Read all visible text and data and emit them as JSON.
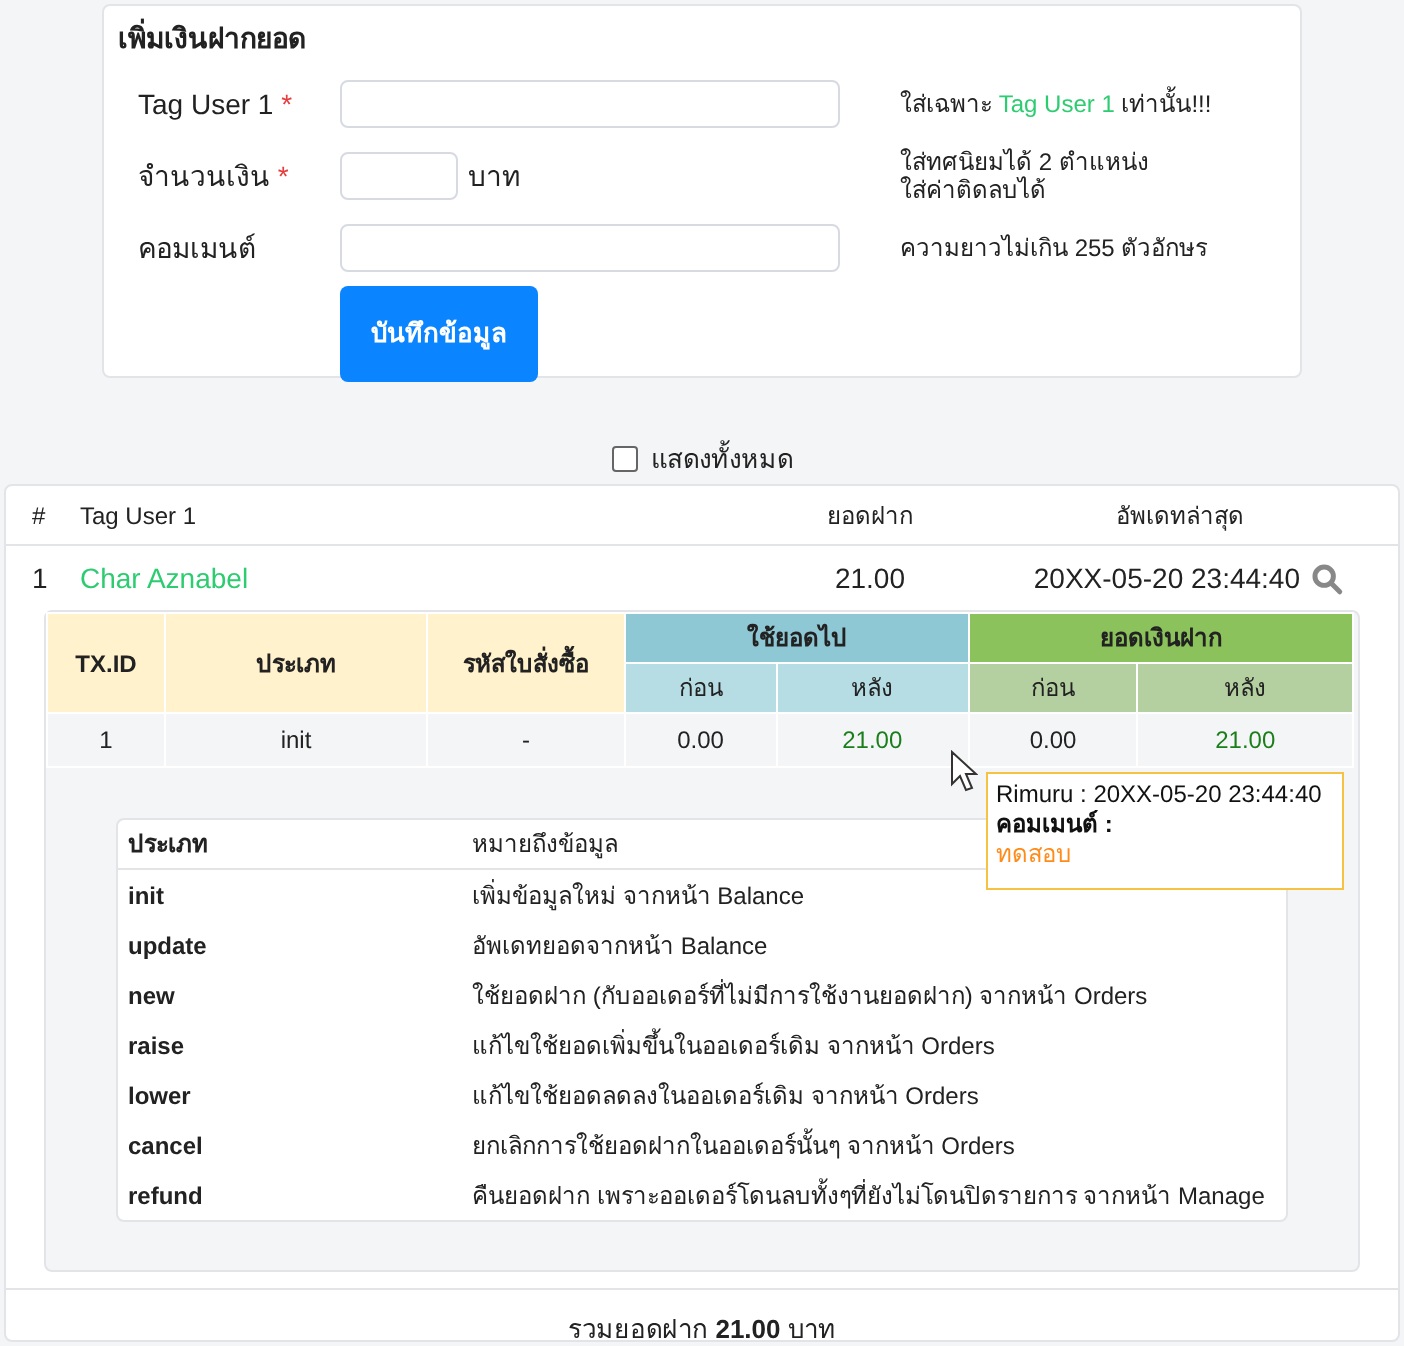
{
  "form": {
    "title": "เพิ่มเงินฝากยอด",
    "fields": [
      {
        "label": "Tag User 1",
        "required_mark": "*",
        "kind": "wide",
        "hint": [
          {
            "text": "ใส่เฉพาะ "
          },
          {
            "text": "Tag User 1",
            "highlight": true
          },
          {
            "text": " เท่านั้น!!!"
          }
        ]
      },
      {
        "label": "จำนวนเงิน",
        "required_mark": "*",
        "kind": "short",
        "unit": "บาท",
        "hint": [
          {
            "text": "ใส่ทศนิยมได้ 2 ตำแหน่ง\nใส่ค่าติดลบได้"
          }
        ]
      },
      {
        "label": "คอมเมนต์",
        "kind": "wide",
        "hint": [
          {
            "text": "ความยาวไม่เกิน 255 ตัวอักษร"
          }
        ]
      }
    ],
    "submit": "บันทึกข้อมูล"
  },
  "show_all": {
    "label": "แสดงทั้งหมด",
    "checked": false
  },
  "table": {
    "columns": [
      "#",
      "Tag User 1",
      "ยอดฝาก",
      "อัพเดทล่าสุด"
    ],
    "rows": [
      {
        "index": "1",
        "user": "Char Aznabel",
        "amount": "21.00",
        "updated": "20XX-05-20 23:44:40",
        "expanded": true,
        "detail": {
          "columns": [
            "TX.ID",
            "ประเภท",
            "รหัสใบสั่งซื้อ"
          ],
          "group_used": "ใช้ยอดไป",
          "group_balance": "ยอดเงินฝาก",
          "sub": [
            "ก่อน",
            "หลัง",
            "ก่อน",
            "หลัง"
          ],
          "rows": [
            {
              "tx_id": "1",
              "type": "init",
              "order": "-",
              "used_before": "0.00",
              "used_after": "21.00",
              "bal_before": "0.00",
              "bal_after": "21.00"
            }
          ]
        },
        "tooltip": {
          "user": "Rimuru",
          "separator": ":",
          "time": "20XX-05-20 23:44:40",
          "comment_label": "คอมเมนต์ :",
          "comment": "ทดสอบ"
        },
        "legend": {
          "columns": [
            "ประเภท",
            "หมายถึงข้อมูล"
          ],
          "rows": [
            {
              "type": "init",
              "meaning": "เพิ่มข้อมูลใหม่ จากหน้า Balance"
            },
            {
              "type": "update",
              "meaning": "อัพเดทยอดจากหน้า Balance"
            },
            {
              "type": "new",
              "meaning": "ใช้ยอดฝาก (กับออเดอร์ที่ไม่มีการใช้งานยอดฝาก) จากหน้า Orders"
            },
            {
              "type": "raise",
              "meaning": "แก้ไขใช้ยอดเพิ่มขึ้นในออเดอร์เดิม จากหน้า Orders"
            },
            {
              "type": "lower",
              "meaning": "แก้ไขใช้ยอดลดลงในออเดอร์เดิม จากหน้า Orders"
            },
            {
              "type": "cancel",
              "meaning": "ยกเลิกการใช้ยอดฝากในออเดอร์นั้นๆ จากหน้า Orders"
            },
            {
              "type": "refund",
              "meaning": "คืนยอดฝาก เพราะออเดอร์โดนลบทั้งๆที่ยังไม่โดนปิดรายการ จากหน้า Manage"
            }
          ]
        }
      }
    ],
    "total": "รวมยอดฝาก **21.00** บาท"
  }
}
